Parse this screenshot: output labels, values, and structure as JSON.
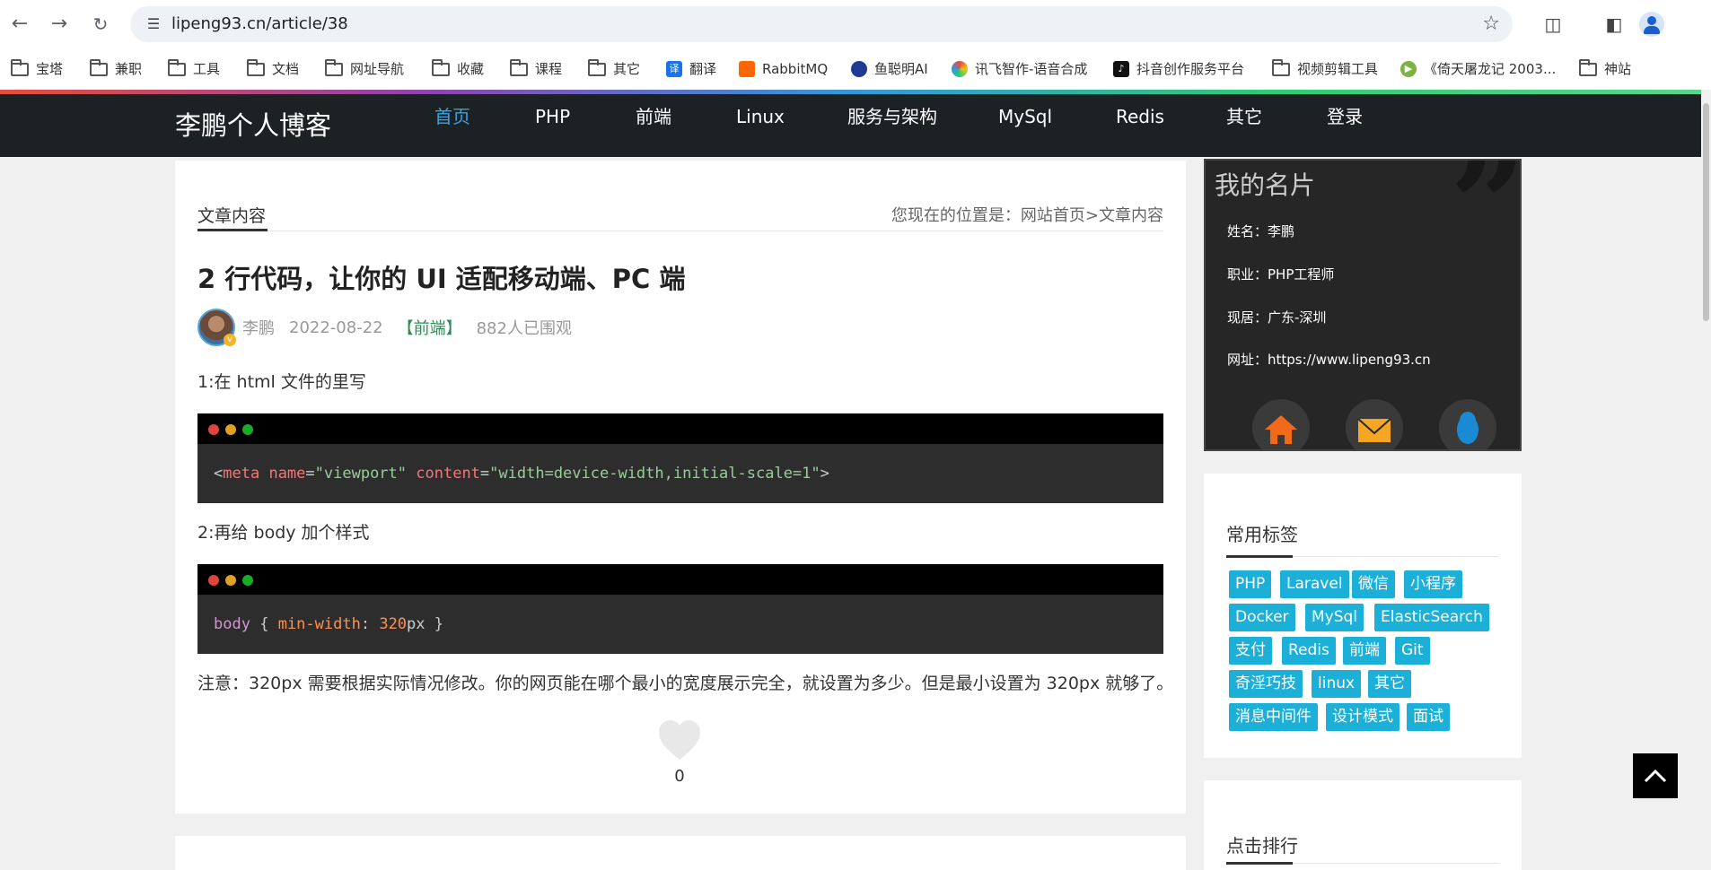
{
  "browser": {
    "url": "lipeng93.cn/article/38",
    "bookmarks": [
      {
        "label": "宝塔",
        "icon": "folder-icon"
      },
      {
        "label": "兼职",
        "icon": "folder-icon"
      },
      {
        "label": "工具",
        "icon": "folder-icon"
      },
      {
        "label": "文档",
        "icon": "folder-icon"
      },
      {
        "label": "网址导航",
        "icon": "folder-icon"
      },
      {
        "label": "收藏",
        "icon": "folder-icon"
      },
      {
        "label": "课程",
        "icon": "folder-icon"
      },
      {
        "label": "其它",
        "icon": "folder-icon"
      },
      {
        "label": "翻译",
        "icon": "translate-icon",
        "icon_glyph": "译"
      },
      {
        "label": "RabbitMQ",
        "icon": "rabbitmq-icon"
      },
      {
        "label": "鱼聪明AI",
        "icon": "fish-eye-icon"
      },
      {
        "label": "讯飞智作-语音合成",
        "icon": "iflytek-icon"
      },
      {
        "label": "抖音创作服务平台",
        "icon": "tiktok-icon"
      },
      {
        "label": "视频剪辑工具",
        "icon": "folder-icon"
      },
      {
        "label": "《倚天屠龙记 2003...",
        "icon": "video-icon"
      },
      {
        "label": "神站",
        "icon": "folder-icon"
      }
    ]
  },
  "site": {
    "logo": "李鹏个人博客",
    "nav": [
      "首页",
      "PHP",
      "前端",
      "Linux",
      "服务与架构",
      "MySql",
      "Redis",
      "其它",
      "登录"
    ]
  },
  "article": {
    "section_tab": "文章内容",
    "breadcrumb": "您现在的位置是：网站首页>文章内容",
    "title": "2 行代码，让你的 UI 适配移动端、PC 端",
    "author": "李鹏",
    "date": "2022-08-22",
    "category": "【前端】",
    "views": "882人已围观",
    "step1": "1:在 html 文件的里写",
    "code1": {
      "lt": "<",
      "tag": "meta",
      "attr1": "name",
      "eq": "=",
      "val1": "\"viewport\"",
      "attr2": "content",
      "val2": "\"width=device-width,initial-scale=1\"",
      "gt": ">"
    },
    "step2": "2:再给 body 加个样式",
    "code2": {
      "selector": "body",
      "open": "{",
      "prop": "min-width",
      "colon": ":",
      "num": "320",
      "unit": "px",
      "close": "}"
    },
    "note": "注意：320px 需要根据实际情况修改。你的网页能在哪个最小的宽度展示完全，就设置为多少。但是最小设置为 320px 就够了。",
    "likes": "0"
  },
  "sidebar": {
    "card": {
      "title": "我的名片",
      "name": "姓名：李鹏",
      "job": "职业：PHP工程师",
      "location": "现居：广东-深圳",
      "site": "网址：https://www.lipeng93.cn",
      "social_icons": [
        "home-icon",
        "mail-icon",
        "qq-penguin-icon"
      ],
      "social_colors": {
        "home": "#f06a1a",
        "mail": "#f5a623",
        "qq": "#1a8ad4"
      }
    },
    "tags_title": "常用标签",
    "tags": [
      "PHP",
      "Laravel",
      "微信",
      "小程序",
      "Docker",
      "MySql",
      "ElasticSearch",
      "支付",
      "Redis",
      "前端",
      "Git",
      "奇淫巧技",
      "linux",
      "其它",
      "消息中间件",
      "设计模式",
      "面试"
    ],
    "rank_title": "点击排行"
  },
  "colors": {
    "nav_bg": "#1c2123",
    "nav_active": "#3aa3e3",
    "tag_bg": "#1cb0d8",
    "category": "#2e8b57"
  }
}
